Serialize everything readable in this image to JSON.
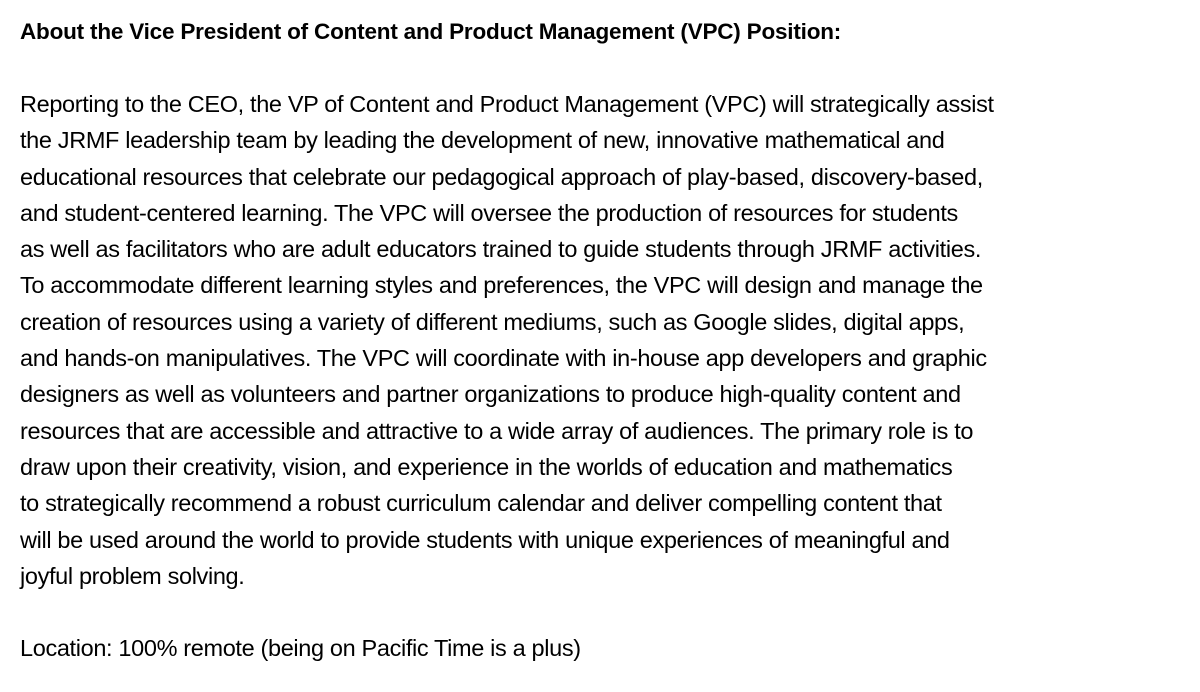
{
  "document": {
    "heading": "About the Vice President of Content and Product Management (VPC) Position:",
    "paragraph_lines": [
      "Reporting to the CEO, the VP of Content and Product Management (VPC) will strategically assist",
      "the JRMF leadership team by leading the development of new, innovative mathematical and",
      "educational resources that celebrate our pedagogical approach of play-based, discovery-based,",
      "and student-centered learning. The VPC will oversee the production of resources for students",
      "as well as facilitators who are adult educators trained to guide students through JRMF activities.",
      "To accommodate different learning styles and preferences, the VPC will design and manage the",
      "creation of resources using a variety of different mediums, such as Google slides, digital apps,",
      "and hands-on manipulatives. The VPC will coordinate with in-house app developers and graphic",
      "designers as well as volunteers and partner organizations to produce high-quality content and",
      "resources that are accessible and attractive to a wide array of audiences. The primary role is to",
      "draw upon their creativity, vision, and experience in the worlds of education and mathematics",
      "to strategically recommend a robust curriculum calendar and deliver compelling content that",
      "will be used around the world to provide students with unique experiences of meaningful and",
      "joyful problem solving."
    ],
    "location": "Location: 100% remote (being on Pacific Time is a plus)"
  }
}
